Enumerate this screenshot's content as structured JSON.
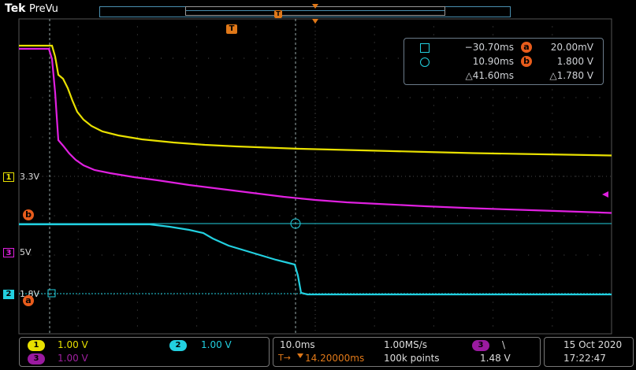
{
  "header": {
    "brand": "Tek",
    "mode": "PreVu",
    "trigger_letter": "T"
  },
  "measurements": {
    "rows": [
      {
        "symbol": "square-cursor-icon",
        "value": "−30.70ms",
        "label": "a",
        "value2": "20.00mV"
      },
      {
        "symbol": "circle-cursor-icon",
        "value": "10.90ms",
        "label": "b",
        "value2": "1.800 V"
      },
      {
        "symbol": "",
        "value": "△41.60ms",
        "label": "",
        "value2": "△1.780 V"
      }
    ]
  },
  "markers": {
    "ch1_level": "3.3V",
    "ch3_level": "5V",
    "ch2_level": "1.8V",
    "ch1_num": "1",
    "ch2_num": "2",
    "ch3_num": "3",
    "cursor_a": "a",
    "cursor_b": "b",
    "trigger_letter": "T"
  },
  "bottom": {
    "ch1": {
      "num": "1",
      "scale": "1.00 V"
    },
    "ch2": {
      "num": "2",
      "scale": "1.00 V"
    },
    "ch3": {
      "num": "3",
      "scale": "1.00 V"
    },
    "timebase": "10.0ms",
    "sample_rate": "1.00MS/s",
    "trigger_pos": "14.20000ms",
    "record": "100k points",
    "trig_ch": "3",
    "trig_slope": "\\",
    "trig_level": "1.48 V",
    "date": "15 Oct  2020",
    "time": "17:22:47"
  },
  "colors": {
    "ch1": "#e8e000",
    "ch2": "#22d0e0",
    "ch3": "#e020e0",
    "accent": "#e07818"
  }
}
